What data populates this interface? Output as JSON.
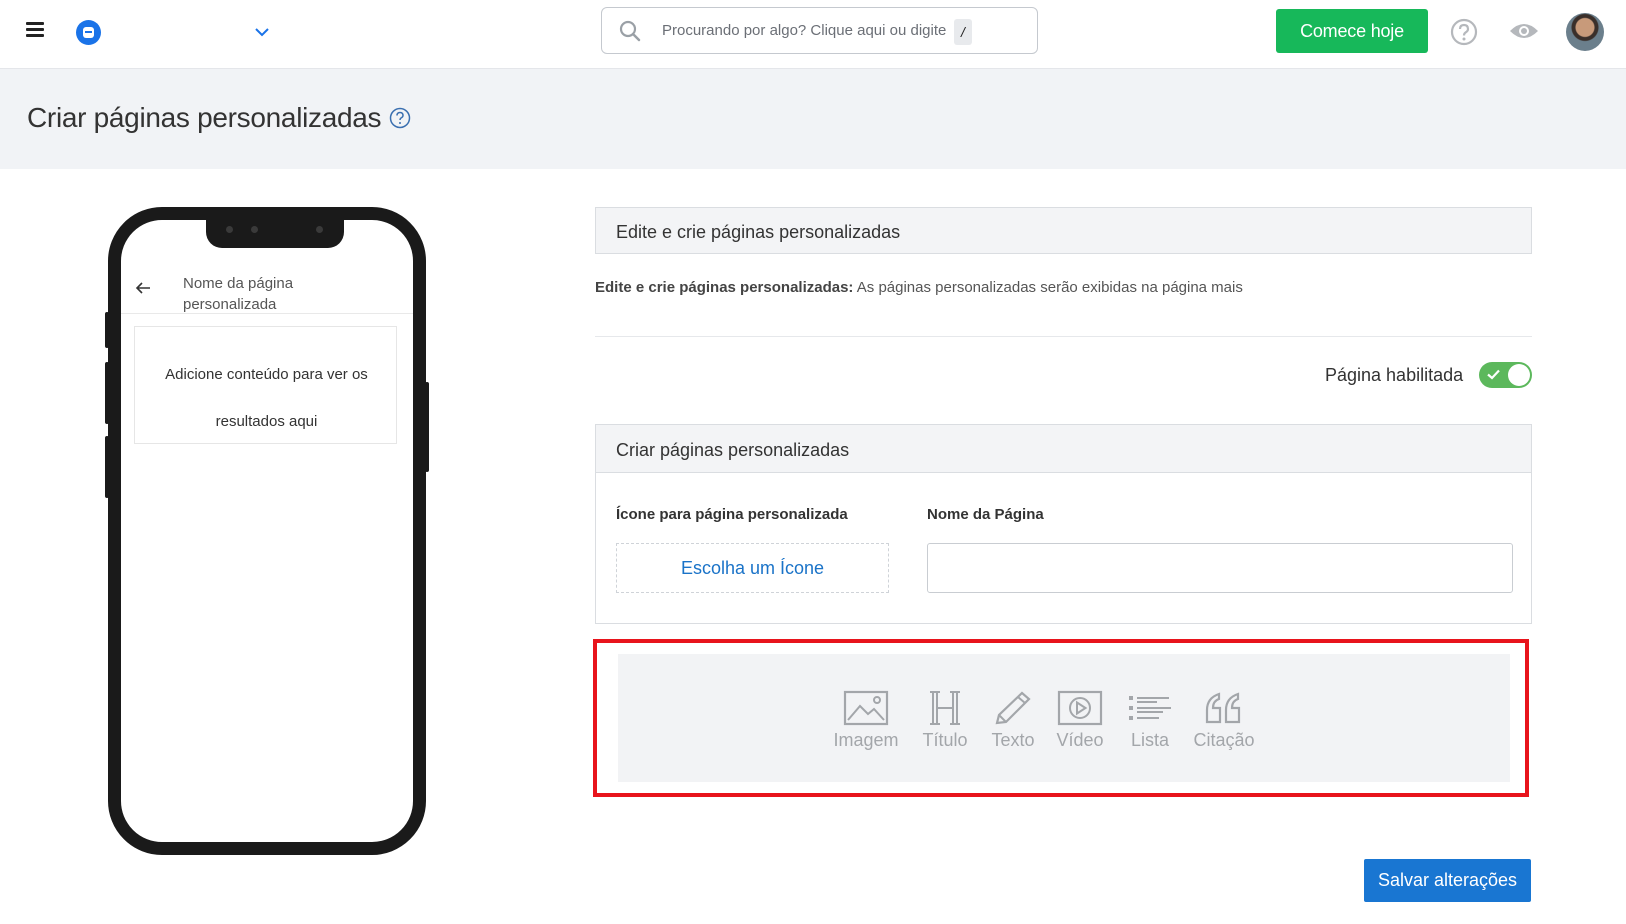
{
  "topbar": {
    "search_placeholder": "Procurando por algo? Clique aqui ou digite",
    "search_shortcut": "/",
    "cta_label": "Comece hoje"
  },
  "header": {
    "title": "Criar páginas personalizadas"
  },
  "preview": {
    "page_name": "Nome da página personalizada",
    "empty_message": "Adicione conteúdo para ver os resultados aqui"
  },
  "editor": {
    "section_title": "Edite e crie páginas personalizadas",
    "description_bold": "Edite e crie páginas personalizadas:",
    "description_text": " As páginas personalizadas serão exibidas na página mais",
    "toggle_label": "Página habilitada",
    "toggle_on": true,
    "card_title": "Criar páginas personalizadas",
    "icon_label": "Ícone para página personalizada",
    "icon_button": "Escolha um Ícone",
    "name_label": "Nome da Página",
    "name_value": ""
  },
  "tools": [
    {
      "label": "Imagem",
      "icon": "image-icon"
    },
    {
      "label": "Título",
      "icon": "heading-icon"
    },
    {
      "label": "Texto",
      "icon": "pencil-icon"
    },
    {
      "label": "Vídeo",
      "icon": "video-icon"
    },
    {
      "label": "Lista",
      "icon": "list-icon"
    },
    {
      "label": "Citação",
      "icon": "quote-icon"
    }
  ],
  "save_label": "Salvar alterações",
  "colors": {
    "cta": "#17b85a",
    "primary": "#1976d2",
    "highlight": "#e8141c",
    "toggle": "#5cb85c"
  }
}
